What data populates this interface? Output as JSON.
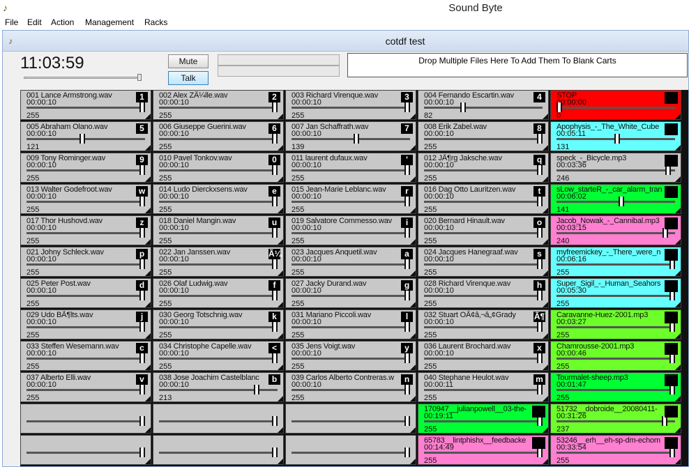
{
  "app": {
    "title": "Sound Byte"
  },
  "menu": [
    {
      "label": "File"
    },
    {
      "label": "Edit"
    },
    {
      "label": "Action"
    },
    {
      "label": "Management"
    },
    {
      "label": "Racks"
    }
  ],
  "window": {
    "title": "cotdf test"
  },
  "clock": {
    "time": "11:03:59"
  },
  "controls": {
    "mute_label": "Mute",
    "talk_label": "Talk",
    "drop_text": "Drop Multiple Files Here To Add Them To Blank Carts"
  },
  "colors": {
    "stop": "#ff0000",
    "cyan": "#66ffff",
    "pink": "#ff7fd0",
    "green": "#6dff2a",
    "lime": "#00ff33",
    "grey": "#c8c8c8"
  },
  "carts": [
    {
      "name": "001 Lance Armstrong.wav",
      "time": "00:00:10",
      "vol": "255",
      "key": "1",
      "color": "grey",
      "level": 1
    },
    {
      "name": "002 Alex ZÃ¼lle.wav",
      "time": "00:00:10",
      "vol": "255",
      "key": "2",
      "color": "grey",
      "level": 1
    },
    {
      "name": "003 Richard Virenque.wav",
      "time": "00:00:10",
      "vol": "255",
      "key": "3",
      "color": "grey",
      "level": 1
    },
    {
      "name": "004 Fernando Escartin.wav",
      "time": "00:00:10",
      "vol": "82",
      "key": "4",
      "color": "grey",
      "level": 0.32
    },
    {
      "name": "STOP",
      "time": "00:00:00",
      "vol": "0",
      "key": "",
      "color": "stop",
      "level": 0
    },
    {
      "name": "005 Abraham Olano.wav",
      "time": "00:00:10",
      "vol": "121",
      "key": "5",
      "color": "grey",
      "level": 0.47
    },
    {
      "name": "006 Giuseppe Guerini.wav",
      "time": "00:00:10",
      "vol": "255",
      "key": "6",
      "color": "grey",
      "level": 1
    },
    {
      "name": "007 Jan Schaffrath.wav",
      "time": "00:00:10",
      "vol": "139",
      "key": "7",
      "color": "grey",
      "level": 0.55
    },
    {
      "name": "008 Erik Zabel.wav",
      "time": "00:00:10",
      "vol": "255",
      "key": "8",
      "color": "grey",
      "level": 1
    },
    {
      "name": "Apophysis_-_The_White_Cube",
      "time": "00:05:11",
      "vol": "131",
      "key": "",
      "color": "cyan",
      "level": 0.51
    },
    {
      "name": "009 Tony Rominger.wav",
      "time": "00:00:10",
      "vol": "255",
      "key": "9",
      "color": "grey",
      "level": 1
    },
    {
      "name": "010 Pavel Tonkov.wav",
      "time": "00:00:10",
      "vol": "255",
      "key": "0",
      "color": "grey",
      "level": 1
    },
    {
      "name": "011 laurent dufaux.wav",
      "time": "00:00:10",
      "vol": "255",
      "key": "'",
      "color": "grey",
      "level": 1
    },
    {
      "name": "012 JÃ¶rg Jaksche.wav",
      "time": "00:00:10",
      "vol": "255",
      "key": "q",
      "color": "grey",
      "level": 1
    },
    {
      "name": "speck_-_Bicycle.mp3",
      "time": "00:03:36",
      "vol": "246",
      "key": "",
      "color": "grey",
      "level": 0.96
    },
    {
      "name": "013 Walter Godefroot.wav",
      "time": "00:00:10",
      "vol": "255",
      "key": "w",
      "color": "grey",
      "level": 1
    },
    {
      "name": "014 Ludo Dierckxsens.wav",
      "time": "00:00:10",
      "vol": "255",
      "key": "e",
      "color": "grey",
      "level": 1
    },
    {
      "name": "015 Jean-Marie Leblanc.wav",
      "time": "00:00:10",
      "vol": "255",
      "key": "r",
      "color": "grey",
      "level": 1
    },
    {
      "name": "016 Dag Otto Lauritzen.wav",
      "time": "00:00:10",
      "vol": "255",
      "key": "t",
      "color": "grey",
      "level": 1
    },
    {
      "name": "sLow_starteR_-_car_alarm_tran",
      "time": "00:06:02",
      "vol": "141",
      "key": "",
      "color": "lime",
      "level": 0.55
    },
    {
      "name": "017 Thor Hushovd.wav",
      "time": "00:00:10",
      "vol": "255",
      "key": "z",
      "color": "grey",
      "level": 1
    },
    {
      "name": "018 Daniel Mangin.wav",
      "time": "00:00:10",
      "vol": "255",
      "key": "u",
      "color": "grey",
      "level": 1
    },
    {
      "name": "019 Salvatore Commesso.wav",
      "time": "00:00:10",
      "vol": "255",
      "key": "i",
      "color": "grey",
      "level": 1
    },
    {
      "name": "020 Bernard Hinault.wav",
      "time": "00:00:10",
      "vol": "255",
      "key": "o",
      "color": "grey",
      "level": 1
    },
    {
      "name": "Jacob_Nowak_-_Cannibal.mp3",
      "time": "00:03:15",
      "vol": "240",
      "key": "",
      "color": "pink",
      "level": 0.94
    },
    {
      "name": "021 Johny Schleck.wav",
      "time": "00:00:10",
      "vol": "255",
      "key": "p",
      "color": "grey",
      "level": 1
    },
    {
      "name": "022 Jan Janssen.wav",
      "time": "00:00:10",
      "vol": "255",
      "key": "Ã¼",
      "color": "grey",
      "level": 1
    },
    {
      "name": "023 Jacques Anquetil.wav",
      "time": "00:00:10",
      "vol": "255",
      "key": "a",
      "color": "grey",
      "level": 1
    },
    {
      "name": "024 Jacques Hanegraaf.wav",
      "time": "00:00:10",
      "vol": "255",
      "key": "s",
      "color": "grey",
      "level": 1
    },
    {
      "name": "myfreemickey_-_There_were_n",
      "time": "00:06:16",
      "vol": "255",
      "key": "",
      "color": "cyan",
      "level": 1
    },
    {
      "name": "025 Peter Post.wav",
      "time": "00:00:10",
      "vol": "255",
      "key": "d",
      "color": "grey",
      "level": 1
    },
    {
      "name": "026 Olaf Ludwig.wav",
      "time": "00:00:10",
      "vol": "255",
      "key": "f",
      "color": "grey",
      "level": 1
    },
    {
      "name": "027 Jacky Durand.wav",
      "time": "00:00:10",
      "vol": "255",
      "key": "g",
      "color": "grey",
      "level": 1
    },
    {
      "name": "028 Richard Virenque.wav",
      "time": "00:00:10",
      "vol": "255",
      "key": "h",
      "color": "grey",
      "level": 1
    },
    {
      "name": "Super_Sigil_-_Human_Seahors",
      "time": "00:05:30",
      "vol": "255",
      "key": "",
      "color": "cyan",
      "level": 1
    },
    {
      "name": "029 Udo BÃ¶lts.wav",
      "time": "00:00:10",
      "vol": "255",
      "key": "j",
      "color": "grey",
      "level": 1
    },
    {
      "name": "030 Georg Totschnig.wav",
      "time": "00:00:10",
      "vol": "255",
      "key": "k",
      "color": "grey",
      "level": 1
    },
    {
      "name": "031 Mariano Piccoli.wav",
      "time": "00:00:10",
      "vol": "255",
      "key": "l",
      "color": "grey",
      "level": 1
    },
    {
      "name": "032 Stuart OÃ¢â‚¬â„¢Grady",
      "time": "00:00:10",
      "vol": "255",
      "key": "Ã¶",
      "color": "grey",
      "level": 1
    },
    {
      "name": "Caravanne-Huez-2001.mp3",
      "time": "00:03:27",
      "vol": "255",
      "key": "",
      "color": "green",
      "level": 1
    },
    {
      "name": "033 Steffen Wesemann.wav",
      "time": "00:00:10",
      "vol": "255",
      "key": "c",
      "color": "grey",
      "level": 1
    },
    {
      "name": "034 Christophe Capelle.wav",
      "time": "00:00:10",
      "vol": "255",
      "key": "<",
      "color": "grey",
      "level": 1
    },
    {
      "name": "035 Jens Voigt.wav",
      "time": "00:00:10",
      "vol": "255",
      "key": "y",
      "color": "grey",
      "level": 1
    },
    {
      "name": "036 Laurent Brochard.wav",
      "time": "00:00:10",
      "vol": "255",
      "key": "x",
      "color": "grey",
      "level": 1
    },
    {
      "name": "Chamrousse-2001.mp3",
      "time": "00:00:46",
      "vol": "255",
      "key": "",
      "color": "green",
      "level": 1
    },
    {
      "name": "037 Alberto Elli.wav",
      "time": "00:00:10",
      "vol": "255",
      "key": "v",
      "color": "grey",
      "level": 1
    },
    {
      "name": "038 Jose Joachim Castelblanc",
      "time": "00:00:10",
      "vol": "213",
      "key": "b",
      "color": "grey",
      "level": 0.84
    },
    {
      "name": "039 Carlos Alberto Contreras.w",
      "time": "00:00:10",
      "vol": "255",
      "key": "n",
      "color": "grey",
      "level": 1
    },
    {
      "name": "040 Stephane Heulot.wav",
      "time": "00:00:11",
      "vol": "255",
      "key": "m",
      "color": "grey",
      "level": 1
    },
    {
      "name": "Tourmalet-sheep.mp3",
      "time": "00:01:47",
      "vol": "255",
      "key": "",
      "color": "lime",
      "level": 1
    },
    {
      "name": "",
      "time": "",
      "vol": "",
      "key": "",
      "color": "grey",
      "level": 1
    },
    {
      "name": "",
      "time": "",
      "vol": "",
      "key": "",
      "color": "grey",
      "level": 1
    },
    {
      "name": "",
      "time": "",
      "vol": "",
      "key": "",
      "color": "grey",
      "level": 1
    },
    {
      "name": "170947__julianpowell__03-the-",
      "time": "00:19:11",
      "vol": "255",
      "key": "",
      "color": "lime",
      "level": 1
    },
    {
      "name": "51732__dobroide__20080411-",
      "time": "00:31:26",
      "vol": "237",
      "key": "",
      "color": "green",
      "level": 0.93
    },
    {
      "name": "",
      "time": "",
      "vol": "",
      "key": "",
      "color": "grey",
      "level": 1
    },
    {
      "name": "",
      "time": "",
      "vol": "",
      "key": "",
      "color": "grey",
      "level": 1
    },
    {
      "name": "",
      "time": "",
      "vol": "",
      "key": "",
      "color": "grey",
      "level": 1
    },
    {
      "name": "65783__lintphishx__feedbacke",
      "time": "00:14:49",
      "vol": "255",
      "key": "",
      "color": "pink",
      "level": 1
    },
    {
      "name": "53246__erh__eh-sp-dm-echom",
      "time": "00:33:54",
      "vol": "255",
      "key": "",
      "color": "pink",
      "level": 1
    }
  ]
}
